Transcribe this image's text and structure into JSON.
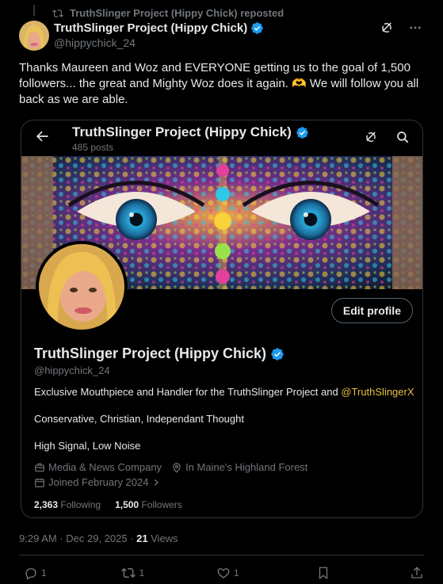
{
  "repost": {
    "text": "TruthSlinger Project (Hippy Chick) reposted"
  },
  "author": {
    "name": "TruthSlinger Project (Hippy Chick)",
    "handle": "@hippychick_24"
  },
  "tweet": {
    "text_part1": "Thanks Maureen and Woz and EVERYONE getting us to the goal of 1,500 followers... the great and Mighty Woz does it again. ",
    "emoji": "🫶",
    "text_part2": " We will follow you all back as we are able."
  },
  "card": {
    "title": "TruthSlinger Project (Hippy Chick)",
    "posts": "485 posts",
    "edit_label": "Edit profile",
    "name": "TruthSlinger Project (Hippy Chick)",
    "handle": "@hippychick_24",
    "bio_text": "Exclusive Mouthpiece and Handler for the TruthSlinger Project and ",
    "bio_link": "@TruthSlingerX",
    "line2": "Conservative, Christian, Independant Thought",
    "line3": "High Signal, Low Noise",
    "category": "Media & News Company",
    "location": "In Maine's Highland Forest",
    "joined": "Joined February 2024",
    "following_count": "2,363",
    "following_label": "Following",
    "followers_count": "1,500",
    "followers_label": "Followers"
  },
  "meta": {
    "time": "9:29 AM · Dec 29, 2025 · ",
    "views_count": "21",
    "views_label": "Views"
  },
  "actions": {
    "replies": "1",
    "reposts": "1",
    "likes": "1"
  },
  "colors": {
    "verified": "#1d9bf0",
    "link": "#e5c13f",
    "background": "#000000"
  }
}
